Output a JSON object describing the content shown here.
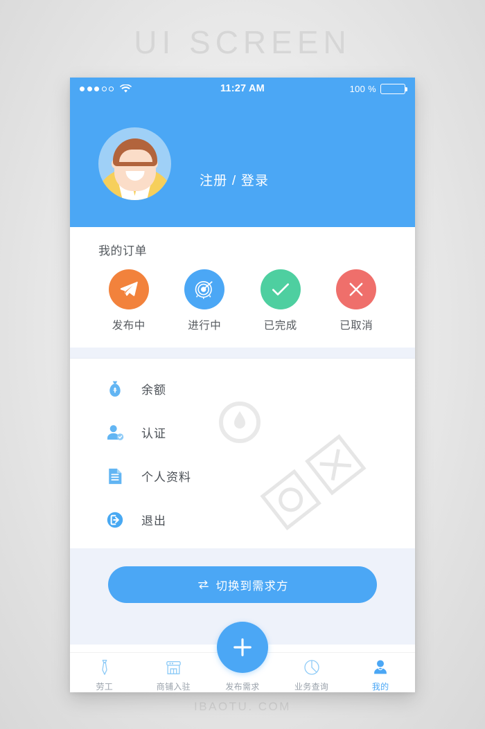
{
  "watermarks": {
    "top": "UI  SCREEN",
    "bottom": "IBAOTU. COM"
  },
  "statusbar": {
    "signal_filled": 3,
    "signal_empty": 2,
    "wifi_icon": "wifi-icon",
    "time": "11:27 AM",
    "battery_percent": "100 %",
    "battery_icon": "battery-full-icon"
  },
  "header": {
    "avatar_icon": "user-avatar",
    "login_label": "注册 / 登录",
    "bg_color": "#4BA7F5"
  },
  "orders": {
    "title": "我的订单",
    "items": [
      {
        "label": "发布中",
        "icon": "paper-plane-icon",
        "color": "#F2823C"
      },
      {
        "label": "进行中",
        "icon": "target-icon",
        "color": "#4BA7F5"
      },
      {
        "label": "已完成",
        "icon": "check-icon",
        "color": "#4ECFA0"
      },
      {
        "label": "已取消",
        "icon": "close-x-icon",
        "color": "#EF6F6B"
      }
    ]
  },
  "menu": {
    "items": [
      {
        "label": "余额",
        "icon": "money-bag-icon"
      },
      {
        "label": "认证",
        "icon": "user-verified-icon"
      },
      {
        "label": "个人资料",
        "icon": "document-icon"
      },
      {
        "label": "退出",
        "icon": "logout-icon"
      }
    ]
  },
  "switch": {
    "icon": "swap-arrows-icon",
    "label": "切换到需求方"
  },
  "tabbar": {
    "items": [
      {
        "label": "劳工",
        "icon": "necktie-icon",
        "active": false
      },
      {
        "label": "商铺入驻",
        "icon": "shop-icon",
        "active": false
      },
      {
        "label": "发布需求",
        "icon": "plus-icon",
        "active": false
      },
      {
        "label": "业务查询",
        "icon": "pie-chart-icon",
        "active": false
      },
      {
        "label": "我的",
        "icon": "person-icon",
        "active": true
      }
    ]
  },
  "colors": {
    "accent": "#4BA7F5",
    "section_bg": "#eef2fa",
    "page_bg": "#eeeeee"
  }
}
